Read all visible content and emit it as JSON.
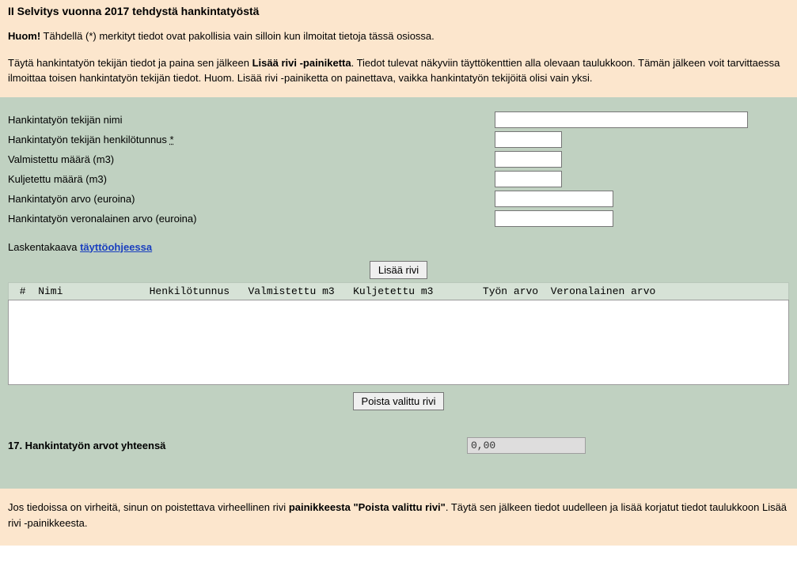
{
  "header": {
    "title": "II Selvitys vuonna 2017 tehdystä hankintatyöstä",
    "note_prefix": "Huom!",
    "note_body": " Tähdellä (*) merkityt tiedot ovat pakollisia vain silloin kun ilmoitat tietoja tässä osiossa.",
    "instr_pre": "Täytä hankintatyön tekijän tiedot ja paina sen jälkeen ",
    "instr_bold": "Lisää rivi -painiketta",
    "instr_post": ". Tiedot tulevat näkyviin täyttökenttien alla olevaan taulukkoon. Tämän jälkeen voit tarvittaessa ilmoittaa toisen hankintatyön tekijän tiedot. Huom. Lisää rivi -painiketta on painettava, vaikka hankintatyön tekijöitä olisi vain yksi."
  },
  "form": {
    "name_label": "Hankintatyön tekijän nimi",
    "name_value": "",
    "ssn_label": "Hankintatyön tekijän henkilötunnus ",
    "ssn_asterisk": "*",
    "ssn_value": "",
    "manuf_label": "Valmistettu määrä (m3)",
    "manuf_value": "",
    "trans_label": "Kuljetettu määrä (m3)",
    "trans_value": "",
    "value_label": "Hankintatyön arvo (euroina)",
    "value_value": "",
    "taxable_label": "Hankintatyön veronalainen arvo (euroina)",
    "taxable_value": "",
    "calc_text": "Laskentakaava ",
    "calc_link": "täyttöohjeessa",
    "add_button": "Lisää rivi",
    "remove_button": "Poista valittu rivi",
    "table_header": " #  Nimi              Henkilötunnus   Valmistettu m3   Kuljetettu m3        Työn arvo  Veronalainen arvo",
    "list_content": ""
  },
  "totals": {
    "label": "17. Hankintatyön arvot yhteensä",
    "value": "0,00"
  },
  "footer": {
    "pre": "Jos tiedoissa on virheitä, sinun on poistettava virheellinen rivi ",
    "bold": "painikkeesta \"Poista valittu rivi\"",
    "post": ". Täytä sen jälkeen tiedot uudelleen ja lisää korjatut tiedot taulukkoon Lisää rivi -painikkeesta."
  }
}
